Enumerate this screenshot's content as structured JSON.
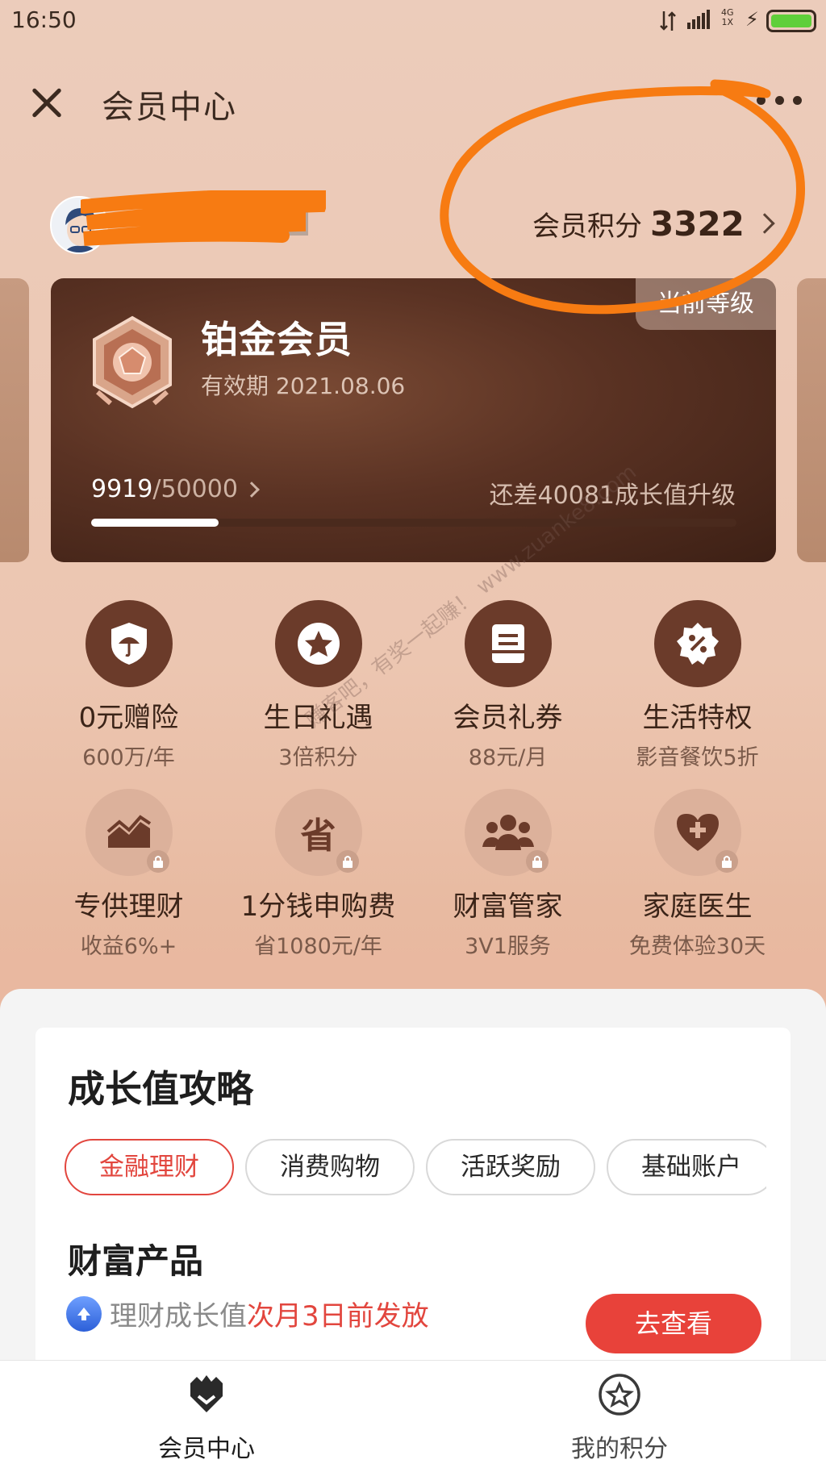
{
  "status_bar": {
    "time": "16:50",
    "network": "4G\n1X"
  },
  "header": {
    "title": "会员中心"
  },
  "user": {
    "points_label": "会员积分",
    "points_value": "3322"
  },
  "level_card": {
    "current_tag": "当前等级",
    "level_name": "铂金会员",
    "validity": "有效期 2021.08.06",
    "growth_current": "9919",
    "growth_separator": "/",
    "growth_total": "50000",
    "growth_progress_fraction": 0.198,
    "upgrade_text": "还差40081成长值升级"
  },
  "perks": [
    {
      "name": "0元赠险",
      "sub": "600万/年",
      "icon": "umbrella-shield-icon",
      "locked": false
    },
    {
      "name": "生日礼遇",
      "sub": "3倍积分",
      "icon": "star-icon",
      "locked": false
    },
    {
      "name": "会员礼券",
      "sub": "88元/月",
      "icon": "coupon-icon",
      "locked": false
    },
    {
      "name": "生活特权",
      "sub": "影音餐饮5折",
      "icon": "discount-badge-icon",
      "locked": false
    },
    {
      "name": "专供理财",
      "sub": "收益6%+",
      "icon": "trend-chart-icon",
      "locked": true
    },
    {
      "name": "1分钱申购费",
      "sub": "省1080元/年",
      "icon": "save-char-icon",
      "locked": true
    },
    {
      "name": "财富管家",
      "sub": "3V1服务",
      "icon": "advisor-group-icon",
      "locked": true
    },
    {
      "name": "家庭医生",
      "sub": "免费体验30天",
      "icon": "heart-plus-icon",
      "locked": true
    }
  ],
  "perk_icon_glyph_save": "省",
  "watermark": "赚客吧，有奖一起赚！ www.zuanke8.com",
  "growth_guide": {
    "title": "成长值攻略",
    "tabs": [
      "金融理财",
      "消费购物",
      "活跃奖励",
      "基础账户"
    ],
    "product_title": "财富产品",
    "product_desc_plain": "理财成长值",
    "product_desc_highlight": "次月3日前发放",
    "button_label": "去查看"
  },
  "tab_bar": {
    "items": [
      "会员中心",
      "我的积分"
    ]
  },
  "colors": {
    "accent_red": "#e2463e",
    "card_brown": "#5a3223",
    "annotation_orange": "#f77b12"
  }
}
